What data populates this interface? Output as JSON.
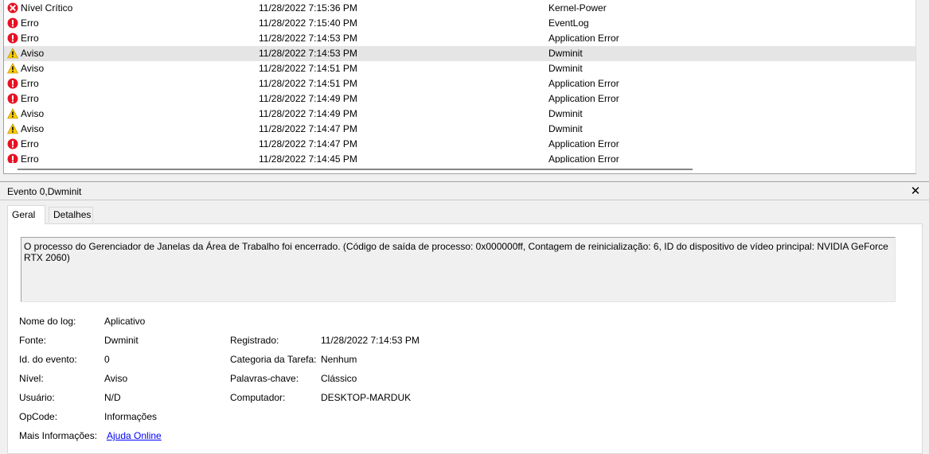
{
  "events": [
    {
      "level": "Nível Crítico",
      "icon": "critical",
      "datetime": "11/28/2022 7:15:36 PM",
      "source": "Kernel-Power",
      "selected": false
    },
    {
      "level": "Erro",
      "icon": "error",
      "datetime": "11/28/2022 7:15:40 PM",
      "source": "EventLog",
      "selected": false
    },
    {
      "level": "Erro",
      "icon": "error",
      "datetime": "11/28/2022 7:14:53 PM",
      "source": "Application Error",
      "selected": false
    },
    {
      "level": "Aviso",
      "icon": "warning",
      "datetime": "11/28/2022 7:14:53 PM",
      "source": "Dwminit",
      "selected": true
    },
    {
      "level": "Aviso",
      "icon": "warning",
      "datetime": "11/28/2022 7:14:51 PM",
      "source": "Dwminit",
      "selected": false
    },
    {
      "level": "Erro",
      "icon": "error",
      "datetime": "11/28/2022 7:14:51 PM",
      "source": "Application Error",
      "selected": false
    },
    {
      "level": "Erro",
      "icon": "error",
      "datetime": "11/28/2022 7:14:49 PM",
      "source": "Application Error",
      "selected": false
    },
    {
      "level": "Aviso",
      "icon": "warning",
      "datetime": "11/28/2022 7:14:49 PM",
      "source": "Dwminit",
      "selected": false
    },
    {
      "level": "Aviso",
      "icon": "warning",
      "datetime": "11/28/2022 7:14:47 PM",
      "source": "Dwminit",
      "selected": false
    },
    {
      "level": "Erro",
      "icon": "error",
      "datetime": "11/28/2022 7:14:47 PM",
      "source": "Application Error",
      "selected": false
    },
    {
      "level": "Erro",
      "icon": "error",
      "datetime": "11/28/2022 7:14:45 PM",
      "source": "Application Error",
      "selected": false
    }
  ],
  "detail": {
    "title": "Evento 0,Dwminit",
    "close_glyph": "✕",
    "tabs": {
      "general": "Geral",
      "details": "Detalhes"
    },
    "description": "O processo do Gerenciador de Janelas da Área de Trabalho foi encerrado. (Código de saída de processo: 0x000000ff, Contagem de reinicialização: 6, ID do dispositivo de vídeo principal: NVIDIA GeForce RTX 2060)",
    "fields": {
      "log_name_label": "Nome do log:",
      "log_name": "Aplicativo",
      "source_label": "Fonte:",
      "source": "Dwminit",
      "logged_label": "Registrado:",
      "logged": "11/28/2022 7:14:53 PM",
      "event_id_label": "Id. do evento:",
      "event_id": "0",
      "task_category_label": "Categoria da Tarefa:",
      "task_category": "Nenhum",
      "level_label": "Nível:",
      "level": "Aviso",
      "keywords_label": "Palavras-chave:",
      "keywords": "Clássico",
      "user_label": "Usuário:",
      "user": "N/D",
      "computer_label": "Computador:",
      "computer": "DESKTOP-MARDUK",
      "opcode_label": "OpCode:",
      "opcode": "Informações",
      "more_info_label": "Mais Informações:",
      "more_info_link": "Ajuda Online"
    }
  },
  "colors": {
    "error": "#e81123",
    "warning": "#ffcc00",
    "selection": "#e5e5e5",
    "link": "#0000ff"
  }
}
